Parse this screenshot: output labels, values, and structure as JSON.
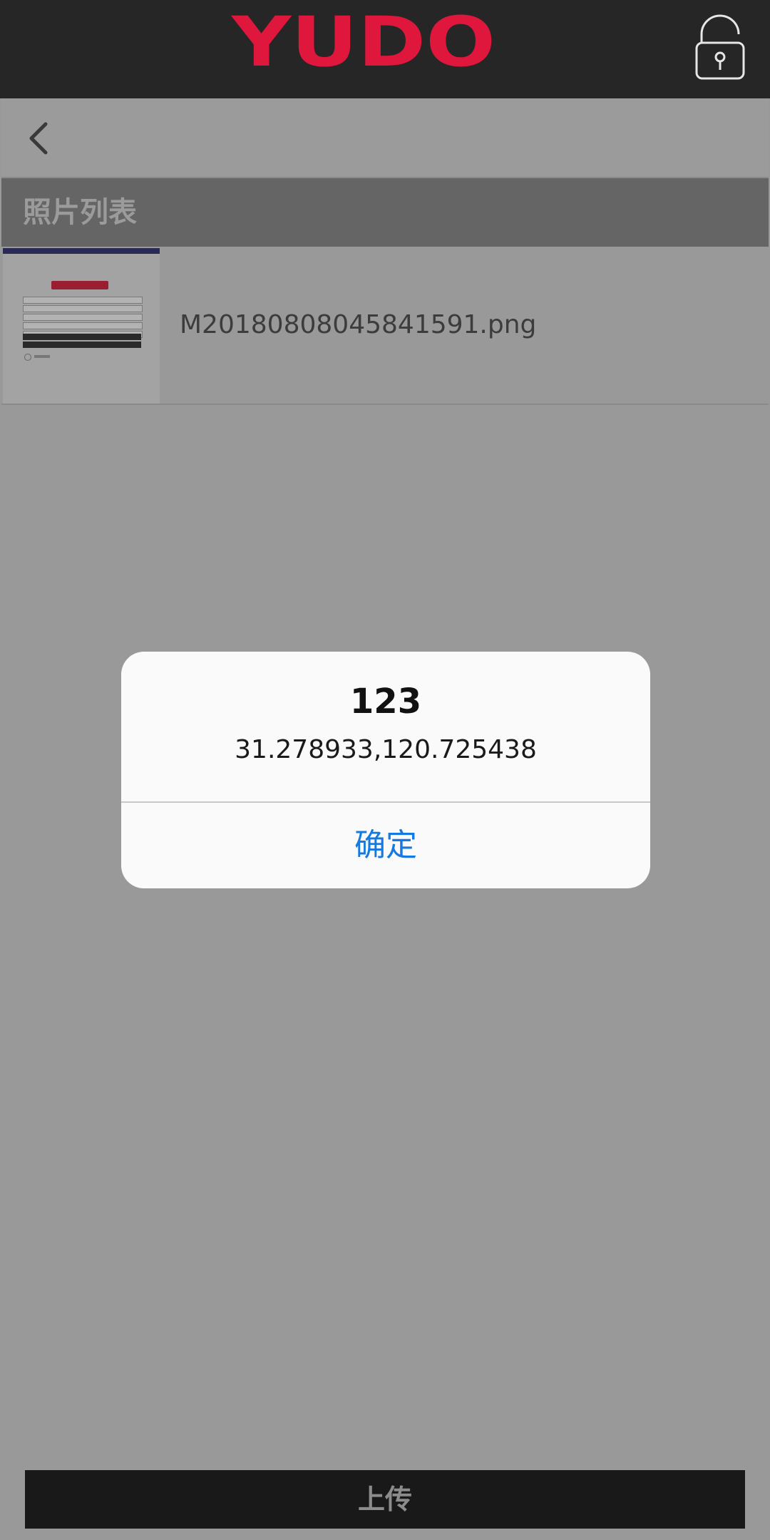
{
  "header": {
    "logo_text": "YUDO",
    "brand_color": "#e0173d",
    "lock_icon": "unlocked-padlock-icon"
  },
  "nav": {
    "back_icon": "chevron-left-icon"
  },
  "section": {
    "title": "照片列表"
  },
  "photos": [
    {
      "filename": "M20180808045841591.png",
      "thumbnail_icon": "screenshot-thumbnail"
    }
  ],
  "footer": {
    "upload_label": "上传"
  },
  "dialog": {
    "title": "123",
    "message": "31.278933,120.725438",
    "ok_label": "确定",
    "ok_color": "#1479e0"
  }
}
